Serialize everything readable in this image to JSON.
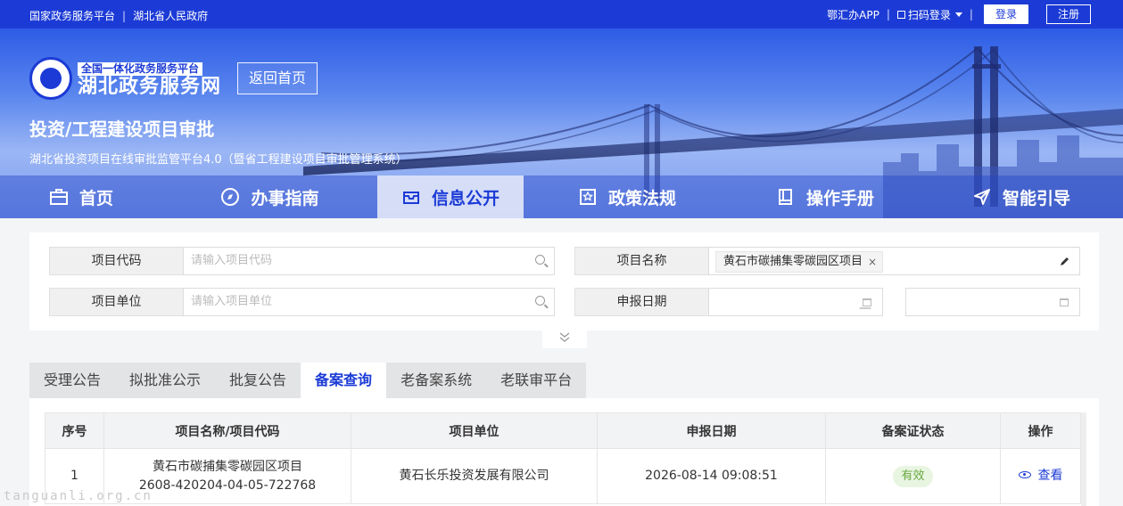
{
  "topbar": {
    "link_national": "国家政务服务平台",
    "link_province": "湖北省人民政府",
    "app_link": "鄂汇办APP",
    "scan_login": "扫码登录",
    "login": "登录",
    "register": "注册"
  },
  "brand": {
    "subtitle": "全国一体化政务服务平台",
    "title": "湖北政务服务网",
    "home_button": "返回首页"
  },
  "system": {
    "title": "投资/工程建设项目审批",
    "subtitle": "湖北省投资项目在线审批监管平台4.0（暨省工程建设项目审批管理系统）"
  },
  "nav": [
    {
      "label": "首页",
      "icon": "briefcase-icon"
    },
    {
      "label": "办事指南",
      "icon": "compass-icon"
    },
    {
      "label": "信息公开",
      "icon": "inbox-icon",
      "active": true
    },
    {
      "label": "政策法规",
      "icon": "star-doc-icon"
    },
    {
      "label": "操作手册",
      "icon": "book-icon"
    },
    {
      "label": "智能引导",
      "icon": "send-icon"
    }
  ],
  "search": {
    "code_label": "项目代码",
    "code_placeholder": "请输入项目代码",
    "name_label": "项目名称",
    "name_tag": "黄石市碳捕集零碳园区项目",
    "unit_label": "项目单位",
    "unit_placeholder": "请输入项目单位",
    "date_label": "申报日期",
    "date_separator": "—"
  },
  "tabs": [
    "受理公告",
    "拟批准公示",
    "批复公告",
    "备案查询",
    "老备案系统",
    "老联审平台"
  ],
  "active_tab": "备案查询",
  "table": {
    "headers": [
      "序号",
      "项目名称/项目代码",
      "项目单位",
      "申报日期",
      "备案证状态",
      "操作"
    ],
    "rows": [
      {
        "index": "1",
        "name": "黄石市碳捕集零碳园区项目",
        "code": "2608-420204-04-05-722768",
        "unit": "黄石长乐投资发展有限公司",
        "date": "2026-08-14 09:08:51",
        "status": "有效",
        "action": "查看"
      }
    ]
  },
  "watermark": "tanguanli.org.cn",
  "colors": {
    "primary": "#1c3bd6",
    "status_green": "#67a83f"
  }
}
